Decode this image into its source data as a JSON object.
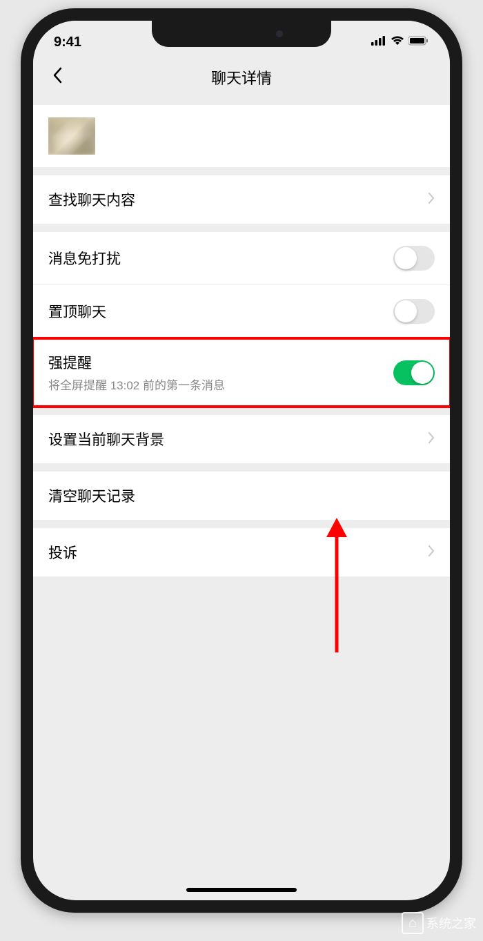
{
  "status": {
    "time": "9:41"
  },
  "nav": {
    "title": "聊天详情"
  },
  "items": {
    "search_content": "查找聊天内容",
    "mute": "消息免打扰",
    "sticky": "置顶聊天",
    "strong_alert": "强提醒",
    "strong_alert_sub": "将全屏提醒 13:02 前的第一条消息",
    "set_background": "设置当前聊天背景",
    "clear_history": "清空聊天记录",
    "report": "投诉"
  },
  "toggles": {
    "mute": false,
    "sticky": false,
    "strong_alert": true
  },
  "watermark": {
    "text": "系统之家"
  }
}
